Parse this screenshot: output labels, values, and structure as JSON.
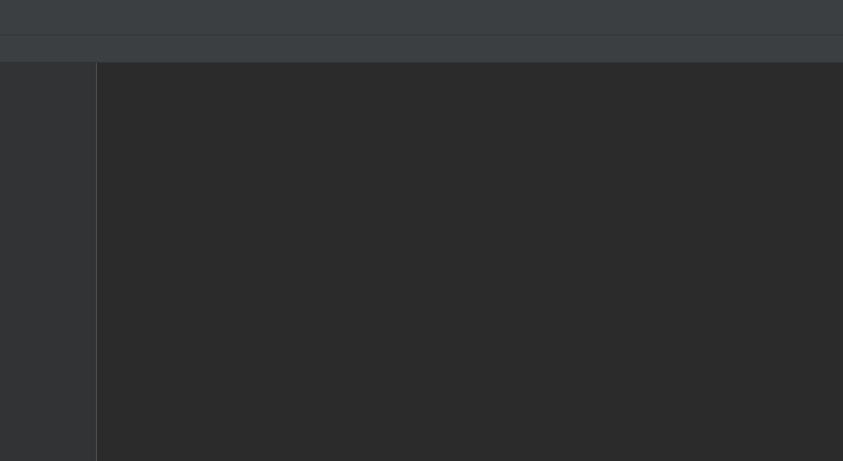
{
  "breadcrumb": {
    "items": []
  },
  "tabs": [],
  "editor": {
    "lines": []
  }
}
